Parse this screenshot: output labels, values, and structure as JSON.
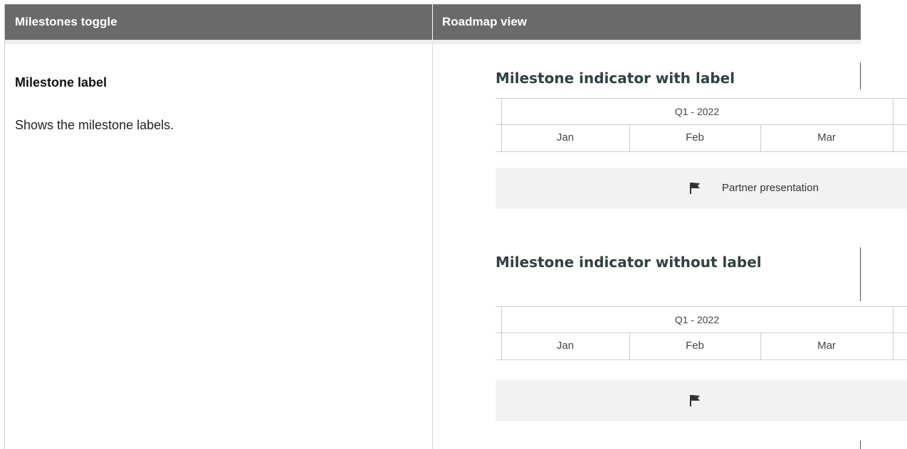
{
  "headers": {
    "col1": "Milestones toggle",
    "col2": "Roadmap view"
  },
  "row": {
    "label_title": "Milestone label",
    "label_description": "Shows the milestone labels."
  },
  "examples": [
    {
      "title": "Milestone indicator with label",
      "quarter": "Q1 - 2022",
      "months": [
        "Jan",
        "Feb",
        "Mar"
      ],
      "milestone_label": "Partner presentation",
      "flag_icon": "flag-icon"
    },
    {
      "title": "Milestone indicator without label",
      "quarter": "Q1 - 2022",
      "months": [
        "Jan",
        "Feb",
        "Mar"
      ],
      "flag_icon": "flag-icon"
    }
  ],
  "colors": {
    "header_bg": "#6a6a6a",
    "example_title": "#2f4240",
    "milestone_bar": "#f2f2f2"
  }
}
